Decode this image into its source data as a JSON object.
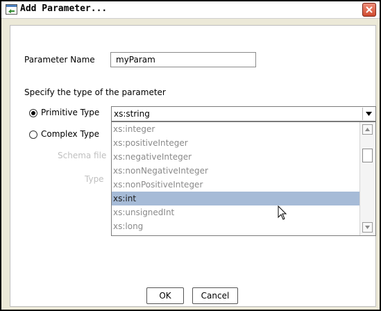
{
  "window": {
    "title": "Add Parameter..."
  },
  "form": {
    "param_name_label": "Parameter Name",
    "param_name_value": "myParam",
    "type_heading": "Specify the type of the parameter",
    "primitive_label": "Primitive Type",
    "complex_label": "Complex Type",
    "schema_file_label": "Schema file",
    "type_label": "Type",
    "selected_type": "xs:string"
  },
  "dropdown": {
    "options": [
      {
        "label": "xs:integer",
        "selected": false
      },
      {
        "label": "xs:positiveInteger",
        "selected": false
      },
      {
        "label": "xs:negativeInteger",
        "selected": false
      },
      {
        "label": "xs:nonNegativeInteger",
        "selected": false
      },
      {
        "label": "xs:nonPositiveInteger",
        "selected": false
      },
      {
        "label": "xs:int",
        "selected": true
      },
      {
        "label": "xs:unsignedInt",
        "selected": false
      },
      {
        "label": "xs:long",
        "selected": false
      }
    ]
  },
  "buttons": {
    "ok": "OK",
    "cancel": "Cancel"
  },
  "icons": {
    "window": "add-parameter-icon",
    "close": "close-icon",
    "dropdown": "chevron-down-icon",
    "cursor": "mouse-pointer-icon"
  },
  "colors": {
    "close_button": "#cf4a2f",
    "selection_highlight": "#a6bbd7"
  }
}
